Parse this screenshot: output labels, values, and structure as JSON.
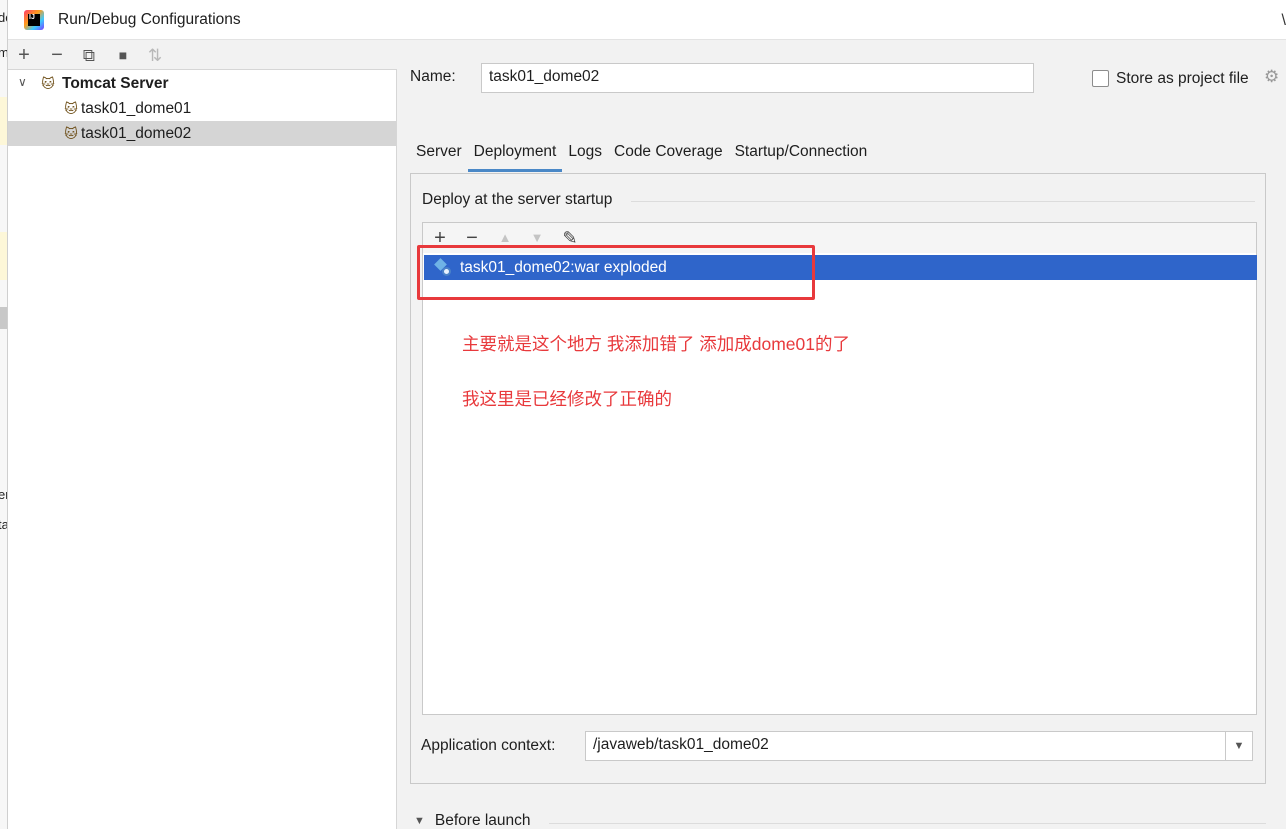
{
  "background_ide": {
    "fragments": [
      "de",
      "m",
      "er",
      "ta"
    ]
  },
  "window": {
    "title": "Run/Debug Configurations",
    "edge_char": "\\"
  },
  "left_panel": {
    "toolbar": {
      "add": "+",
      "remove": "−",
      "copy": "⧉",
      "folder": "■",
      "sort": "⇅"
    },
    "tree": {
      "root_label": "Tomcat Server",
      "items": [
        {
          "label": "task01_dome01"
        },
        {
          "label": "task01_dome02"
        }
      ]
    }
  },
  "form": {
    "name_label": "Name:",
    "name_value": "task01_dome02",
    "store_label": "Store as project file",
    "store_checked": false
  },
  "tabs": [
    {
      "label": "Server"
    },
    {
      "label": "Deployment"
    },
    {
      "label": "Logs"
    },
    {
      "label": "Code Coverage"
    },
    {
      "label": "Startup/Connection"
    }
  ],
  "deployment": {
    "section_title": "Deploy at the server startup",
    "toolbar": {
      "add": "+",
      "remove": "−",
      "up": "▲",
      "down": "▼",
      "edit": "✎"
    },
    "artifacts": [
      {
        "label": "task01_dome02:war exploded"
      }
    ],
    "application_context_label": "Application context:",
    "application_context_value": "/javaweb/task01_dome02"
  },
  "annotation": {
    "color": "#e8393c",
    "line1": "主要就是这个地方 我添加错了 添加成dome01的了",
    "line2": "我这里是已经修改了正确的"
  },
  "before_launch": {
    "label": "Before launch"
  },
  "colors": {
    "selection": "#2f65ca",
    "tab_underline": "#4a88c7",
    "tree_selected": "#d5d5d5"
  }
}
